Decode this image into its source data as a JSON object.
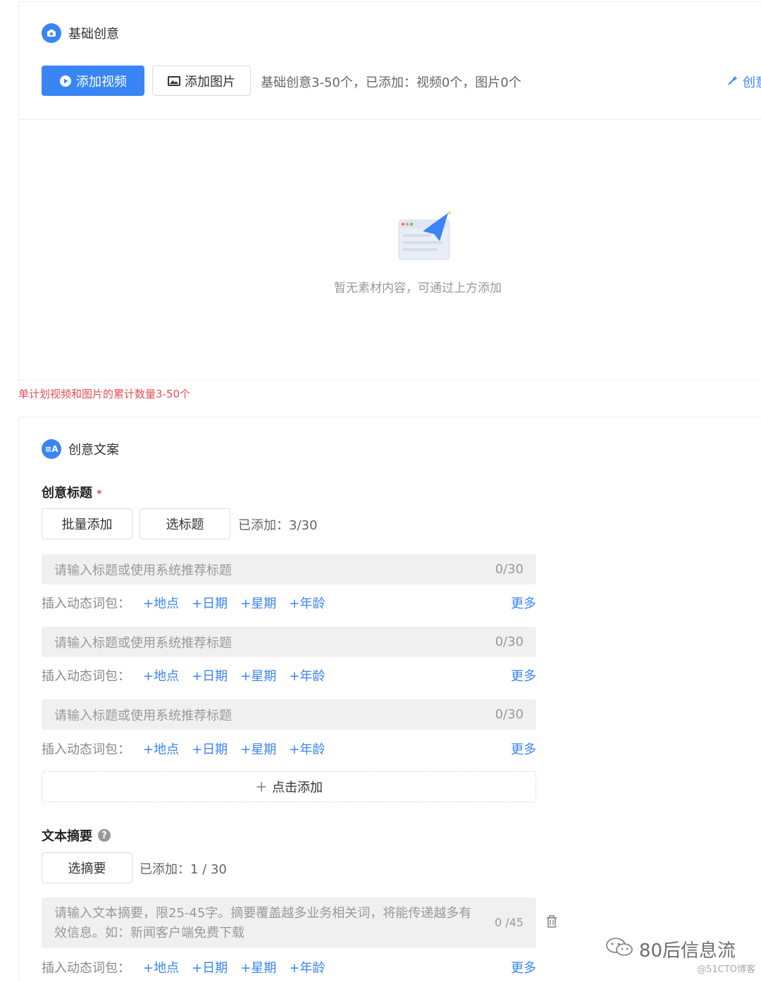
{
  "basic": {
    "title": "基础创意",
    "add_video": "添加视频",
    "add_image": "添加图片",
    "info": "基础创意3-50个，已添加：视频0个，图片0个",
    "right_link": "创意",
    "empty_text": "暂无素材内容，可通过上方添加"
  },
  "warning": "单计划视频和图片的累计数量3-50个",
  "copy": {
    "title": "创意文案",
    "icon_text": "≡A",
    "headline_label": "创意标题",
    "required_mark": "*",
    "batch_add": "批量添加",
    "select_title": "选标题",
    "added": "已添加：3/30",
    "inputs": [
      {
        "placeholder": "请输入标题或使用系统推荐标题",
        "count": "0/30"
      },
      {
        "placeholder": "请输入标题或使用系统推荐标题",
        "count": "0/30"
      },
      {
        "placeholder": "请输入标题或使用系统推荐标题",
        "count": "0/30"
      }
    ],
    "dyn_label": "插入动态词包：",
    "tags": [
      "+地点",
      "+日期",
      "+星期",
      "+年龄"
    ],
    "more": "更多",
    "click_add": "点击添加",
    "summary_label": "文本摘要",
    "select_summary": "选摘要",
    "summary_added": "已添加：1 / 30",
    "summary_placeholder": "请输入文本摘要，限25-45字。摘要覆盖越多业务相关词，将能传递越多有效信息。如：新闻客户端免费下载",
    "summary_count": "0 /45"
  },
  "watermark": {
    "main": "80后信息流",
    "sub": "@51CTO博客"
  },
  "colors": {
    "primary": "#3a85f5",
    "warning": "#e34d59",
    "input_bg": "#f0f0f0"
  }
}
